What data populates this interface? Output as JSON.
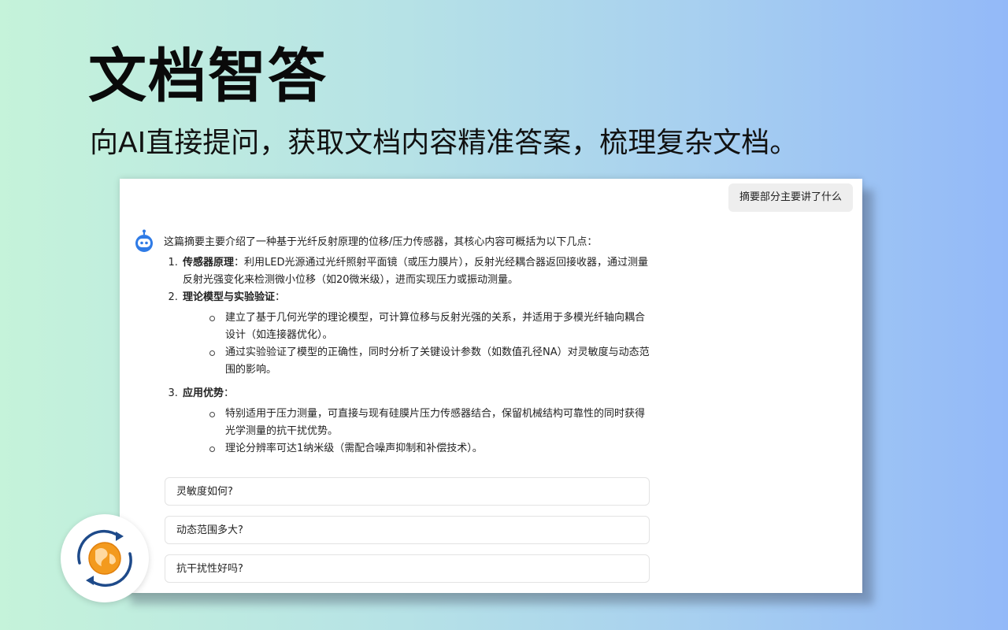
{
  "hero": {
    "title": "文档智答",
    "subtitle": "向AI直接提问，获取文档内容精准答案，梳理复杂文档。"
  },
  "chat": {
    "user_message": "摘要部分主要讲了什么",
    "answer": {
      "intro": "这篇摘要主要介绍了一种基于光纤反射原理的位移/压力传感器，其核心内容可概括为以下几点：",
      "items": [
        {
          "title": "传感器原理",
          "text": "：利用LED光源通过光纤照射平面镜（或压力膜片），反射光经耦合器返回接收器，通过测量反射光强变化来检测微小位移（如20微米级），进而实现压力或振动测量。"
        },
        {
          "title": "理论模型与实验验证",
          "text": "：",
          "bullets": [
            "建立了基于几何光学的理论模型，可计算位移与反射光强的关系，并适用于多模光纤轴向耦合设计（如连接器优化）。",
            "通过实验验证了模型的正确性，同时分析了关键设计参数（如数值孔径NA）对灵敏度与动态范围的影响。"
          ]
        },
        {
          "title": "应用优势",
          "text": "：",
          "bullets": [
            "特别适用于压力测量，可直接与现有硅膜片压力传感器结合，保留机械结构可靠性的同时获得光学测量的抗干扰优势。",
            "理论分辨率可达1纳米级（需配合噪声抑制和补偿技术）。"
          ]
        }
      ]
    },
    "suggestions": [
      "灵敏度如何?",
      "动态范围多大?",
      "抗干扰性好吗?"
    ]
  },
  "icons": {
    "bot_avatar": "robot-icon",
    "app_logo": "globe-sync-logo-icon"
  },
  "colors": {
    "accent_blue": "#2f7be6",
    "logo_orange": "#f39a1e",
    "logo_navy": "#1e4a8a"
  }
}
